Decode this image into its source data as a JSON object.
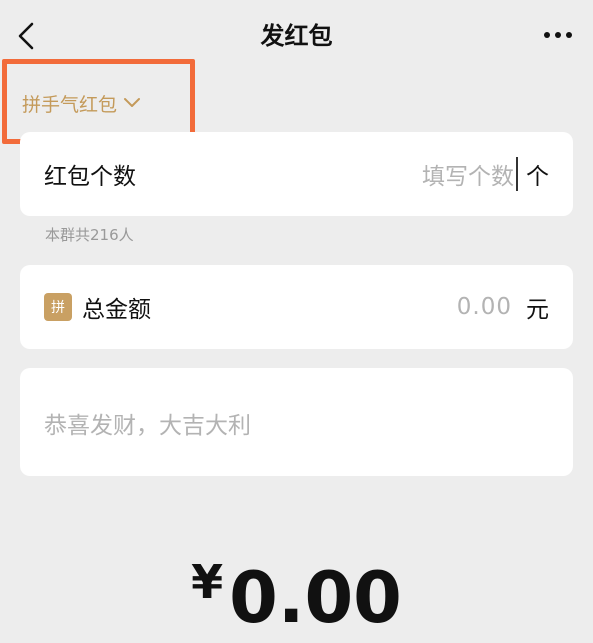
{
  "nav": {
    "title": "发红包",
    "back_icon": "chevron-left-icon",
    "more_icon": "more-horizontal-icon"
  },
  "packet_type": {
    "label": "拼手气红包",
    "icon": "chevron-down-icon",
    "color": "#c49a5a"
  },
  "count_field": {
    "label": "红包个数",
    "placeholder": "填写个数",
    "unit": "个"
  },
  "group_hint": "本群共216人",
  "amount_field": {
    "badge": "拼",
    "label": "总金额",
    "placeholder": "0.00",
    "unit": "元"
  },
  "greeting_field": {
    "placeholder": "恭喜发财，大吉大利"
  },
  "total": {
    "currency": "¥",
    "amount": "0.00"
  },
  "colors": {
    "background": "#ededed",
    "accent_gold": "#c49a5a",
    "highlight_orange": "#f26b3a"
  }
}
